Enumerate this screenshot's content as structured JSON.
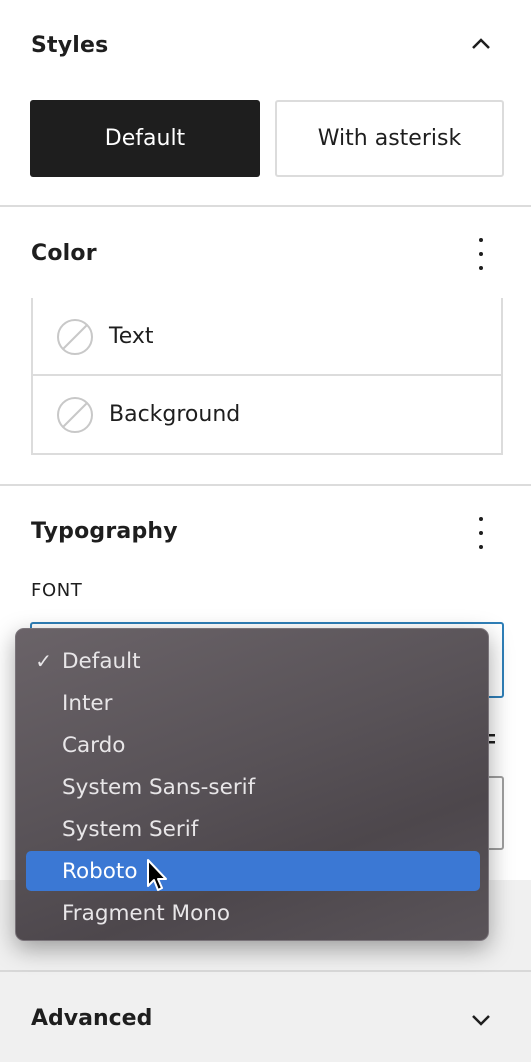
{
  "styles": {
    "title": "Styles",
    "buttons": [
      "Default",
      "With asterisk"
    ]
  },
  "color": {
    "title": "Color",
    "items": [
      {
        "label": "Text",
        "icon": "no-color-icon"
      },
      {
        "label": "Background",
        "icon": "no-color-icon"
      }
    ]
  },
  "typography": {
    "title": "Typography",
    "font_label": "FONT"
  },
  "font_menu": {
    "selected": "Default",
    "highlighted": "Roboto",
    "options": [
      "Default",
      "Inter",
      "Cardo",
      "System Sans-serif",
      "System Serif",
      "Roboto",
      "Fragment Mono"
    ],
    "highlight_color": "#3b78d4",
    "check_mark": "✓"
  },
  "advanced": {
    "title": "Advanced"
  },
  "colors": {
    "primary_dark": "#1e1e1e",
    "focus_border": "#2f7fb8"
  }
}
